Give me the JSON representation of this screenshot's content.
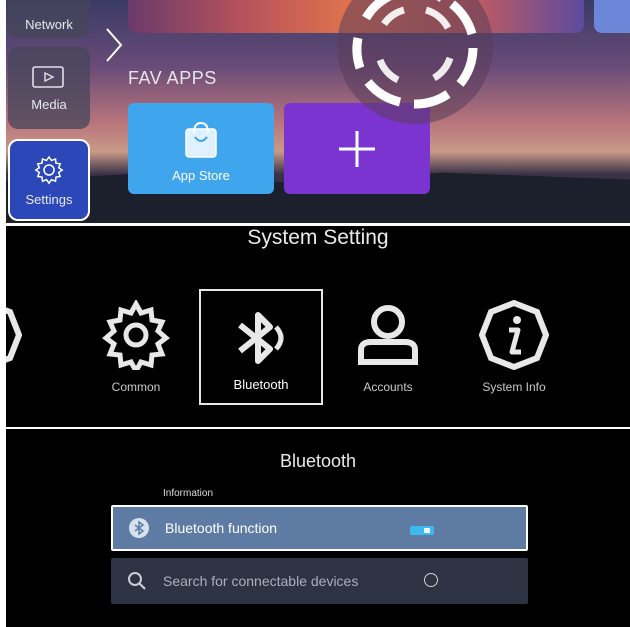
{
  "launcher": {
    "nav": [
      {
        "label": "Network",
        "icon": "network-icon"
      },
      {
        "label": "Media",
        "icon": "media-icon"
      },
      {
        "label": "Settings",
        "icon": "gear-icon",
        "selected": true
      }
    ],
    "fav_title": "FAV APPS",
    "apps": [
      {
        "label": "App Store",
        "icon": "shopping-bag-icon",
        "color": "#3fa6ee"
      },
      {
        "label": "",
        "icon": "plus-icon",
        "color": "#7c34d0"
      }
    ]
  },
  "system_setting": {
    "title": "System Setting",
    "categories": [
      {
        "label": "me",
        "icon": "clock-icon"
      },
      {
        "label": "Common",
        "icon": "gear-icon"
      },
      {
        "label": "Bluetooth",
        "icon": "bluetooth-icon",
        "selected": true
      },
      {
        "label": "Accounts",
        "icon": "user-icon"
      },
      {
        "label": "System Info",
        "icon": "info-icon"
      }
    ]
  },
  "bluetooth": {
    "title": "Bluetooth",
    "section_label": "Information",
    "rows": [
      {
        "label": "Bluetooth function",
        "icon": "bluetooth-icon",
        "state": "on"
      },
      {
        "label": "Search for connectable devices",
        "icon": "search-icon",
        "state": "loading"
      }
    ]
  },
  "colors": {
    "accent_blue": "#2c48b8",
    "selected_row": "#5d7ba3",
    "toggle_on": "#3fb8f0"
  }
}
